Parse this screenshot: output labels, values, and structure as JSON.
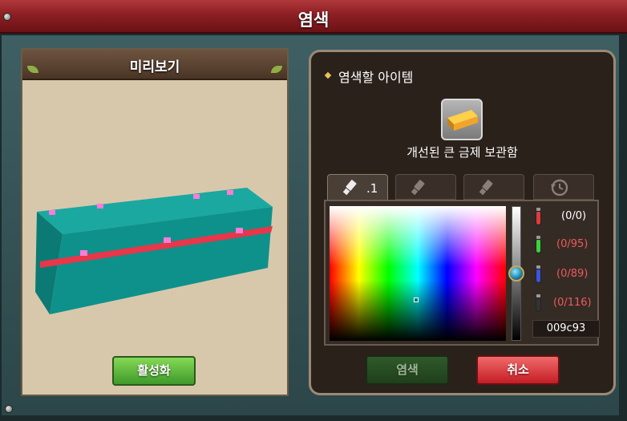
{
  "window": {
    "title": "염색"
  },
  "preview": {
    "header": "미리보기",
    "activate_label": "활성화",
    "chest_color": "#009c93"
  },
  "dye": {
    "section_title": "염색할 아이템",
    "item": {
      "name": "개선된 큰 금제 보관함",
      "icon": "golden-chest-icon"
    },
    "tabs": [
      {
        "icon": "brush-icon",
        "label": ".1",
        "active": true
      },
      {
        "icon": "brush-icon",
        "label": "",
        "active": false
      },
      {
        "icon": "brush-icon",
        "label": "",
        "active": false
      },
      {
        "icon": "history-icon",
        "label": "",
        "active": false
      }
    ],
    "rgb": [
      {
        "channel": "red",
        "value": "(0/0)",
        "vial_color": "#e23a3a",
        "text_color": "#ffffff"
      },
      {
        "channel": "green",
        "value": "(0/95)",
        "vial_color": "#3cd23c",
        "text_color": "#f05a5a"
      },
      {
        "channel": "blue",
        "value": "(0/89)",
        "vial_color": "#3a55e0",
        "text_color": "#f05a5a"
      },
      {
        "channel": "black",
        "value": "(0/116)",
        "vial_color": "#333333",
        "text_color": "#f05a5a"
      }
    ],
    "hex_value": "009c93",
    "dye_label": "염색",
    "cancel_label": "취소"
  }
}
